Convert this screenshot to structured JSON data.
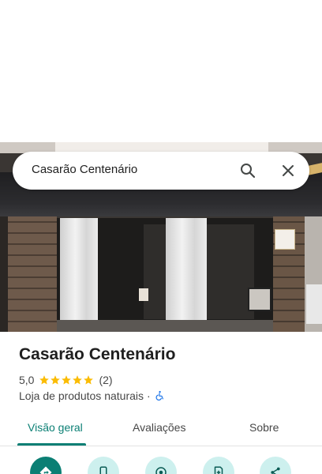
{
  "search": {
    "query": "Casarão Centenário"
  },
  "place": {
    "name": "Casarão Centenário",
    "rating": "5,0",
    "stars": 5,
    "review_count": "(2)",
    "category": "Loja de produtos naturais",
    "separator": "·",
    "wheelchair_accessible": true
  },
  "tabs": [
    {
      "label": "Visão geral",
      "active": true
    },
    {
      "label": "Avaliações",
      "active": false
    },
    {
      "label": "Sobre",
      "active": false
    }
  ],
  "actions": [
    {
      "icon": "directions-icon"
    },
    {
      "icon": "phone-icon"
    },
    {
      "icon": "explore-icon"
    },
    {
      "icon": "save-icon"
    },
    {
      "icon": "share-icon"
    }
  ],
  "colors": {
    "accent": "#0b7f74",
    "accent_light": "#cdf0ee",
    "star": "#fbbc04",
    "accessibility": "#1a73e8"
  }
}
